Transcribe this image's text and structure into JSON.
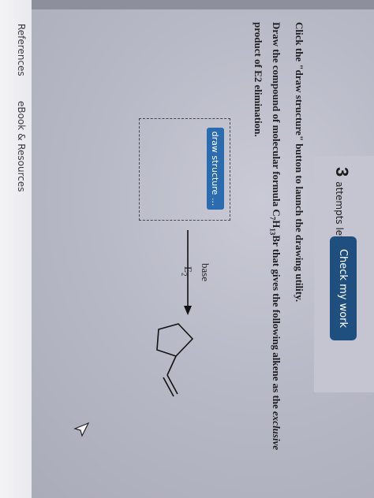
{
  "header": {
    "attempts_count": "3",
    "attempts_label": "attempts left",
    "check_button": "Check my work"
  },
  "question": {
    "line1": "Click the \"draw structure\" button to launch the drawing utility.",
    "line2_pre": "Draw the compound of molecular formula C",
    "formula_c_sub": "7",
    "formula_h": "H",
    "formula_h_sub": "13",
    "formula_br": "Br that gives the following alkene as the ",
    "exclusive": "exclusive",
    "line2_post": "product of E2 elimination."
  },
  "answer_area": {
    "draw_button": "draw structure ..."
  },
  "reaction": {
    "reagent_top": "base",
    "reagent_bottom": "E",
    "reagent_bottom_sub": "2"
  },
  "footer": {
    "references": "References",
    "ebook": "eBook & Resources"
  },
  "colors": {
    "check_button_bg": "#1f4f7e",
    "draw_button_bg": "#2b6cb0"
  }
}
